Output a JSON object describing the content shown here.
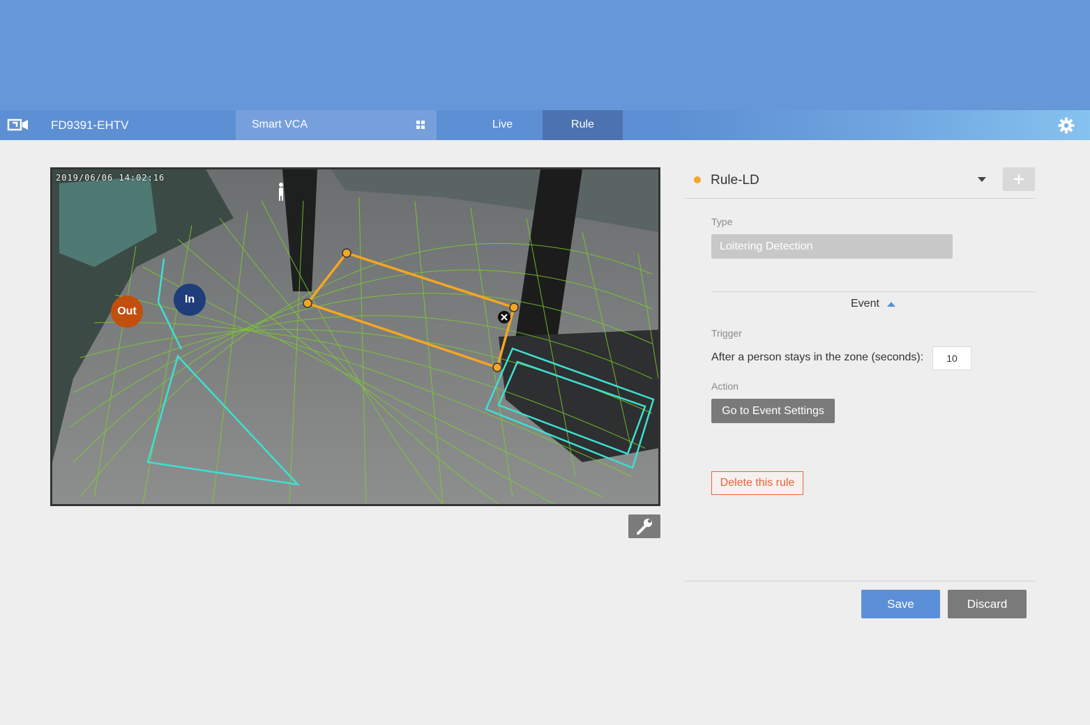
{
  "header": {
    "device_name": "FD9391-EHTV",
    "section": "Smart VCA",
    "tabs": [
      {
        "label": "Live",
        "active": false
      },
      {
        "label": "Rule",
        "active": true
      }
    ],
    "icons": {
      "logo": "camera-logo-icon",
      "apps": "grid-icon",
      "settings": "gear-icon"
    }
  },
  "video": {
    "timestamp": "2019/06/06 14:02:16",
    "zones": {
      "out_label": "Out",
      "in_label": "In"
    },
    "colors": {
      "loiter_zone": "#f5a623",
      "include_zone": "#3de0d2",
      "grid": "#7ccf2e"
    }
  },
  "rule": {
    "name": "Rule-LD",
    "status_color": "#f5a623",
    "type_label": "Type",
    "type_value": "Loitering Detection",
    "event_label": "Event",
    "trigger_label": "Trigger",
    "trigger_text": "After a person stays in the zone (seconds):",
    "trigger_value": "10",
    "action_label": "Action",
    "action_button": "Go to Event Settings",
    "delete_button": "Delete this rule"
  },
  "footer": {
    "save": "Save",
    "discard": "Discard"
  }
}
